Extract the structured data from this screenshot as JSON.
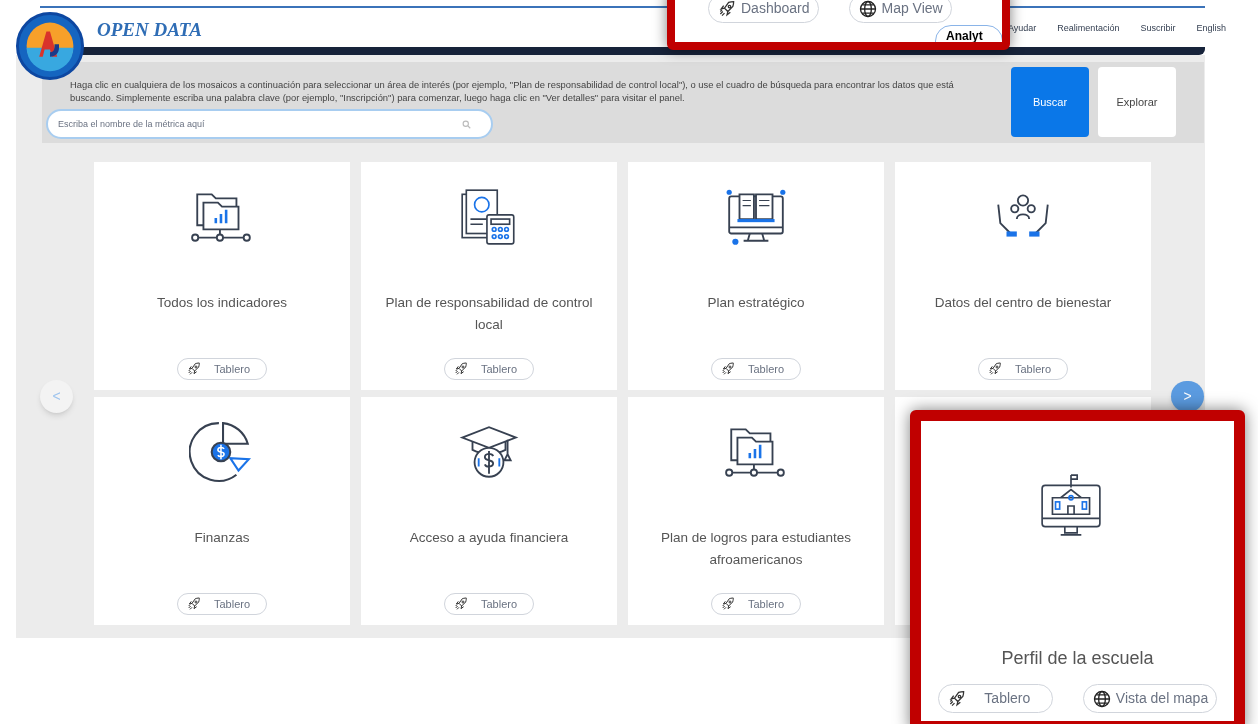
{
  "header": {
    "title": "OPEN DATA",
    "nav": [
      "Ayudar",
      "Realimentación",
      "Suscribir",
      "English"
    ]
  },
  "top_callout": {
    "buttons": [
      {
        "kind": "dashboard",
        "label": "Dashboard"
      },
      {
        "kind": "map",
        "label": "Map View"
      }
    ],
    "tab": "Analyt"
  },
  "intro": "Haga clic en cualquiera de los mosaicos a continuación para seleccionar un área de interés (por ejemplo, \"Plan de responsabilidad de control local\"), o use el cuadro de búsqueda para encontrar los datos que está buscando. Simplemente escriba una palabra clave (por ejemplo, \"Inscripción\") para comenzar, luego haga clic en \"Ver detalles\" para visitar el panel.",
  "search": {
    "placeholder": "Escriba el nombre de la métrica aquí"
  },
  "actions": [
    {
      "kind": "primary",
      "label": "Buscar"
    },
    {
      "kind": "secondary",
      "label": "Explorar"
    }
  ],
  "carousel": {
    "prev": "<",
    "next": ">"
  },
  "tiles": [
    {
      "kind": "folder",
      "title": "Todos los indicadores",
      "buttons": [
        {
          "kind": "dashboard",
          "label": "Tablero"
        }
      ]
    },
    {
      "kind": "calculator",
      "title": "Plan de responsabilidad de control local",
      "buttons": [
        {
          "kind": "dashboard",
          "label": "Tablero"
        }
      ]
    },
    {
      "kind": "book",
      "title": "Plan estratégico",
      "buttons": [
        {
          "kind": "dashboard",
          "label": "Tablero"
        }
      ]
    },
    {
      "kind": "hands",
      "title": "Datos del centro de bienestar",
      "buttons": [
        {
          "kind": "dashboard",
          "label": "Tablero"
        }
      ]
    },
    {
      "kind": "pie",
      "title": "Finanzas",
      "buttons": [
        {
          "kind": "dashboard",
          "label": "Tablero"
        }
      ]
    },
    {
      "kind": "cap",
      "title": "Acceso a ayuda financiera",
      "buttons": [
        {
          "kind": "dashboard",
          "label": "Tablero"
        }
      ]
    },
    {
      "kind": "folder",
      "title": "Plan de logros para estudiantes afroamericanos",
      "buttons": [
        {
          "kind": "dashboard",
          "label": "Tablero"
        }
      ]
    }
  ],
  "tile_callout": {
    "kind": "school",
    "title": "Perfil de la escuela",
    "buttons": [
      {
        "kind": "dashboard",
        "label": "Tablero"
      },
      {
        "kind": "map",
        "label": "Vista del mapa"
      }
    ]
  }
}
